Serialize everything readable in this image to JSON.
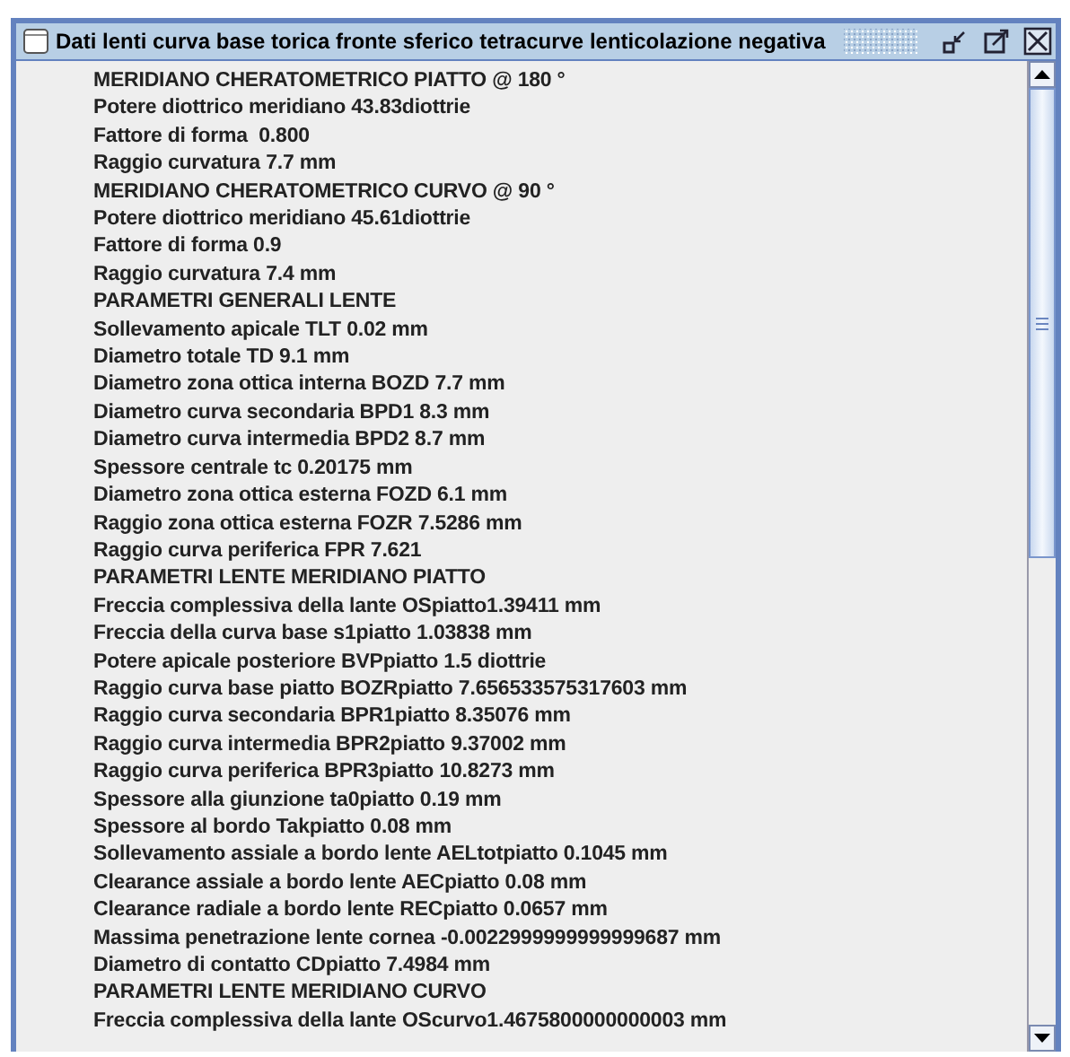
{
  "window": {
    "title": "Dati lenti curva base torica fronte sferico tetracurve lenticolazione negativa"
  },
  "lines": [
    "MERIDIANO CHERATOMETRICO PIATTO @ 180 °",
    "Potere diottrico meridiano 43.83diottrie",
    "Fattore di forma  0.800",
    "Raggio curvatura 7.7 mm",
    "MERIDIANO CHERATOMETRICO CURVO @ 90 °",
    "Potere diottrico meridiano 45.61diottrie",
    "Fattore di forma 0.9",
    "Raggio curvatura 7.4 mm",
    "PARAMETRI GENERALI LENTE",
    "Sollevamento apicale TLT 0.02 mm",
    "Diametro totale TD 9.1 mm",
    "Diametro zona ottica interna BOZD 7.7 mm",
    "Diametro curva secondaria BPD1 8.3 mm",
    "Diametro curva intermedia BPD2 8.7 mm",
    "Spessore centrale tc 0.20175 mm",
    "Diametro zona ottica esterna FOZD 6.1 mm",
    "Raggio zona ottica esterna FOZR 7.5286 mm",
    "Raggio curva periferica FPR 7.621",
    "PARAMETRI LENTE MERIDIANO PIATTO",
    "Freccia complessiva della lante OSpiatto1.39411 mm",
    "Freccia della curva base s1piatto 1.03838 mm",
    "Potere apicale posteriore BVPpiatto 1.5 diottrie",
    "Raggio curva base piatto BOZRpiatto 7.656533575317603 mm",
    "Raggio curva secondaria BPR1piatto 8.35076 mm",
    "Raggio curva intermedia BPR2piatto 9.37002 mm",
    "Raggio curva periferica BPR3piatto 10.8273 mm",
    "Spessore alla giunzione ta0piatto 0.19 mm",
    "Spessore al bordo Takpiatto 0.08 mm",
    "Sollevamento assiale a bordo lente AELtotpiatto 0.1045 mm",
    "Clearance assiale a bordo lente AECpiatto 0.08 mm",
    "Clearance radiale a bordo lente RECpiatto 0.0657 mm",
    "Massima penetrazione lente cornea -0.0022999999999999687 mm",
    "Diametro di contatto CDpiatto 7.4984 mm",
    "PARAMETRI LENTE MERIDIANO CURVO",
    "Freccia complessiva della lante OScurvo1.4675800000000003 mm"
  ]
}
